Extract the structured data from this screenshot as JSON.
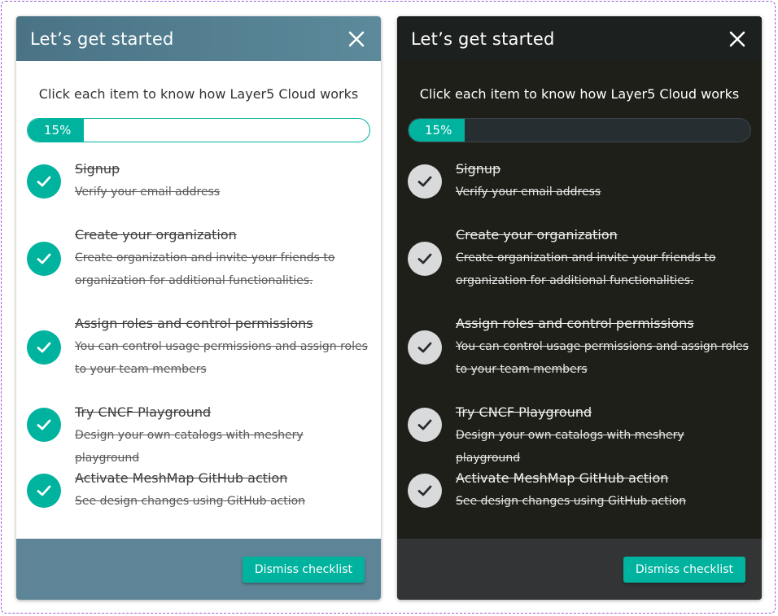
{
  "colors": {
    "accent": "#00b39f",
    "light_header": "#4a7386",
    "light_footer": "#5e8597",
    "dark_background": "#1e1f18",
    "dark_footer": "#333435",
    "dark_check_circle": "#d8dadc"
  },
  "panels": [
    {
      "theme": "light",
      "title": "Let’s get started",
      "close_icon": "close-icon",
      "subtitle": "Click each item to know how Layer5 Cloud works",
      "progress": {
        "percent": 15,
        "label": "15%"
      },
      "items": [
        {
          "title": "Signup",
          "description": "Verify your email address",
          "completed": true
        },
        {
          "title": "Create your organization",
          "description": "Create organization and invite your friends to organization for additional functionalities.",
          "completed": true
        },
        {
          "title": "Assign roles and control permissions",
          "description": "You can control usage permissions and assign roles to your team members",
          "completed": true
        },
        {
          "title": "Try CNCF Playground",
          "description": "Design your own catalogs with meshery playground",
          "completed": true
        },
        {
          "title": "Activate MeshMap GitHub action",
          "description": "See design changes using GitHub action",
          "completed": true
        }
      ],
      "dismiss_label": "Dismiss checklist"
    },
    {
      "theme": "dark",
      "title": "Let’s get started",
      "close_icon": "close-icon",
      "subtitle": "Click each item to know how Layer5 Cloud works",
      "progress": {
        "percent": 15,
        "label": "15%"
      },
      "items": [
        {
          "title": "Signup",
          "description": "Verify your email address",
          "completed": true
        },
        {
          "title": "Create your organization",
          "description": "Create organization and invite your friends to organization for additional functionalities.",
          "completed": true
        },
        {
          "title": "Assign roles and control permissions",
          "description": "You can control usage permissions and assign roles to your team members",
          "completed": true
        },
        {
          "title": "Try CNCF Playground",
          "description": "Design your own catalogs with meshery playground",
          "completed": true
        },
        {
          "title": "Activate MeshMap GitHub action",
          "description": "See design changes using GitHub action",
          "completed": true
        }
      ],
      "dismiss_label": "Dismiss checklist"
    }
  ]
}
